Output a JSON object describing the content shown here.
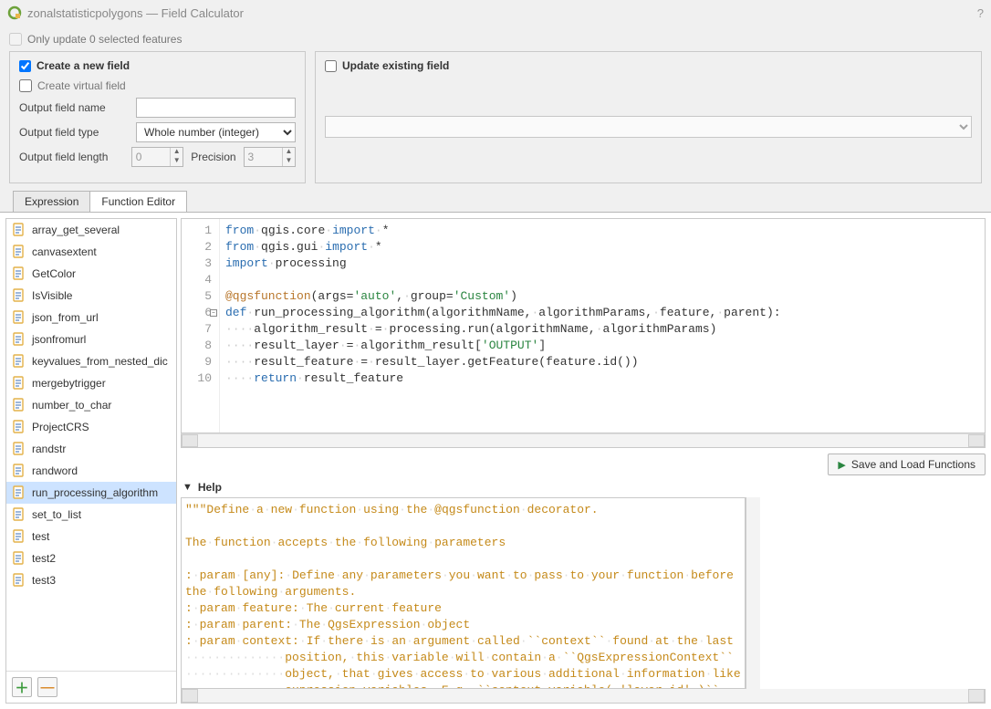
{
  "title": "zonalstatisticpolygons — Field Calculator",
  "only_update": {
    "label": "Only update 0 selected features",
    "checked": false
  },
  "create_new_field": {
    "header": "Create a new field",
    "checked": true,
    "create_virtual_label": "Create virtual field",
    "create_virtual_checked": false,
    "output_name_label": "Output field name",
    "output_name_value": "",
    "output_type_label": "Output field type",
    "output_type_value": "Whole number (integer)",
    "output_length_label": "Output field length",
    "output_length_value": "0",
    "precision_label": "Precision",
    "precision_value": "3"
  },
  "update_existing": {
    "header": "Update existing field",
    "checked": false
  },
  "tabs": {
    "expression": "Expression",
    "function_editor": "Function Editor",
    "active": "function_editor"
  },
  "functions": [
    "array_get_several",
    "canvasextent",
    "GetColor",
    "IsVisible",
    "json_from_url",
    "jsonfromurl",
    "keyvalues_from_nested_dic",
    "mergebytrigger",
    "number_to_char",
    "ProjectCRS",
    "randstr",
    "randword",
    "run_processing_algorithm",
    "set_to_list",
    "test",
    "test2",
    "test3"
  ],
  "selected_function": "run_processing_algorithm",
  "code_lines": [
    {
      "n": 1,
      "html": "<span class='kw'>from</span><span class='ws'>·</span>qgis.core<span class='ws'>·</span><span class='kw'>import</span><span class='ws'>·</span>*"
    },
    {
      "n": 2,
      "html": "<span class='kw'>from</span><span class='ws'>·</span>qgis.gui<span class='ws'>·</span><span class='kw'>import</span><span class='ws'>·</span>*"
    },
    {
      "n": 3,
      "html": "<span class='kw'>import</span><span class='ws'>·</span>processing"
    },
    {
      "n": 4,
      "html": ""
    },
    {
      "n": 5,
      "html": "<span class='dec'>@qgsfunction</span>(args=<span class='st'>'auto'</span>,<span class='ws'>·</span>group=<span class='st'>'Custom'</span>)"
    },
    {
      "n": 6,
      "fold": true,
      "html": "<span class='kw'>def</span><span class='ws'>·</span>run_processing_algorithm(algorithmName,<span class='ws'>·</span>algorithmParams,<span class='ws'>·</span>feature,<span class='ws'>·</span>parent):"
    },
    {
      "n": 7,
      "html": "<span class='ws'>····</span>algorithm_result<span class='ws'>·</span>=<span class='ws'>·</span>processing.run(algorithmName,<span class='ws'>·</span>algorithmParams)"
    },
    {
      "n": 8,
      "html": "<span class='ws'>····</span>result_layer<span class='ws'>·</span>=<span class='ws'>·</span>algorithm_result[<span class='st'>'OUTPUT'</span>]"
    },
    {
      "n": 9,
      "html": "<span class='ws'>····</span>result_feature<span class='ws'>·</span>=<span class='ws'>·</span>result_layer.getFeature(feature.id())"
    },
    {
      "n": 10,
      "html": "<span class='ws'>····</span><span class='kw'>return</span><span class='ws'>·</span>result_feature"
    }
  ],
  "save_button": "Save and Load Functions",
  "help_header": "Help",
  "help_html": "<span class='doc'>\"\"\"Define<span class='ws'>·</span>a<span class='ws'>·</span>new<span class='ws'>·</span>function<span class='ws'>·</span>using<span class='ws'>·</span>the<span class='ws'>·</span>@qgsfunction<span class='ws'>·</span>decorator.\n\nThe<span class='ws'>·</span>function<span class='ws'>·</span>accepts<span class='ws'>·</span>the<span class='ws'>·</span>following<span class='ws'>·</span>parameters\n\n:<span class='ws'>·</span>param<span class='ws'>·</span>[any]:<span class='ws'>·</span>Define<span class='ws'>·</span>any<span class='ws'>·</span>parameters<span class='ws'>·</span>you<span class='ws'>·</span>want<span class='ws'>·</span>to<span class='ws'>·</span>pass<span class='ws'>·</span>to<span class='ws'>·</span>your<span class='ws'>·</span>function<span class='ws'>·</span>before\nthe<span class='ws'>·</span>following<span class='ws'>·</span>arguments.\n:<span class='ws'>·</span>param<span class='ws'>·</span>feature:<span class='ws'>·</span>The<span class='ws'>·</span>current<span class='ws'>·</span>feature\n:<span class='ws'>·</span>param<span class='ws'>·</span>parent:<span class='ws'>·</span>The<span class='ws'>·</span>QgsExpression<span class='ws'>·</span>object\n:<span class='ws'>·</span>param<span class='ws'>·</span>context:<span class='ws'>·</span>If<span class='ws'>·</span>there<span class='ws'>·</span>is<span class='ws'>·</span>an<span class='ws'>·</span>argument<span class='ws'>·</span>called<span class='ws'>·</span>``context``<span class='ws'>·</span>found<span class='ws'>·</span>at<span class='ws'>·</span>the<span class='ws'>·</span>last\n<span class='ws'>··············</span>position,<span class='ws'>·</span>this<span class='ws'>·</span>variable<span class='ws'>·</span>will<span class='ws'>·</span>contain<span class='ws'>·</span>a<span class='ws'>·</span>``QgsExpressionContext``\n<span class='ws'>··············</span>object,<span class='ws'>·</span>that<span class='ws'>·</span>gives<span class='ws'>·</span>access<span class='ws'>·</span>to<span class='ws'>·</span>various<span class='ws'>·</span>additional<span class='ws'>·</span>information<span class='ws'>·</span>like\n<span class='ws'>··············</span>expression<span class='ws'>·</span>variables.<span class='ws'>·</span>E.g.<span class='ws'>·</span>``context.variable(<span class='ws'>·</span>'layer_id'<span class='ws'>·</span>)``</span>"
}
